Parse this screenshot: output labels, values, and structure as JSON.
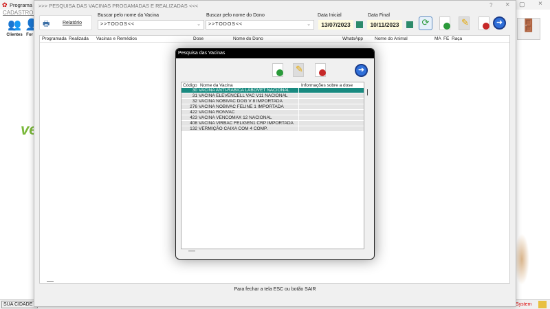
{
  "app": {
    "title": "Programa C",
    "menu": "CADASTROS",
    "toolbar": [
      "Clientes",
      "For"
    ],
    "status_city": "SUA CIDADE -",
    "status_system": "System",
    "logo_text": "ve"
  },
  "window": {
    "title": ">>> PESQUISA DAS VACINAS PROGAMADAS E REALIZADAS <<<",
    "help": "?",
    "close": "×",
    "report_label": "Relatório",
    "vaccine_label": "Buscar pelo nome da Vacina",
    "vaccine_value": ">>TODOS<<",
    "owner_label": "Buscar pelo nome do Dono",
    "owner_value": ">>TODOS<<",
    "start_label": "Data Inicial",
    "start_value": "13/07/2023",
    "end_label": "Data Final",
    "end_value": "10/11/2023",
    "columns": [
      "Programada",
      "Realizada",
      "Vacinas e Remédios",
      "Dose",
      "Nome do Dono",
      "WhatsApp",
      "Nome do Animal",
      "MA",
      "FE",
      "Raça"
    ],
    "footer": "Para fechar a tela ESC ou botão SAIR"
  },
  "dialog": {
    "title": "Pesquisa das Vacinas",
    "columns": [
      "Código",
      "Nome da Vacina",
      "Informações sobre a dose"
    ],
    "rows": [
      {
        "code": "30",
        "name": "VACINA ANTI-RABICA LABOVET NACIONAL",
        "info": ""
      },
      {
        "code": "31",
        "name": "VACINA ELEVENCELL VAC V11 NACIONAL",
        "info": ""
      },
      {
        "code": "32",
        "name": "VACINA NOBIVAC DOG V 8 IMPORTADA",
        "info": ""
      },
      {
        "code": "276",
        "name": "VACINA NOBIVAC FELINE 1 IMPORTADA",
        "info": ""
      },
      {
        "code": "422",
        "name": "VACINA RONVAC",
        "info": ""
      },
      {
        "code": "423",
        "name": "VACINA VENCOMAX 12 NACIONAL",
        "info": ""
      },
      {
        "code": "408",
        "name": "VACINA VIRBAC FELIGEN1 CRP IMPORTADA",
        "info": ""
      },
      {
        "code": "132",
        "name": "VERMIÇÃO CAIXA COM 4 COMP.",
        "info": ""
      }
    ]
  }
}
